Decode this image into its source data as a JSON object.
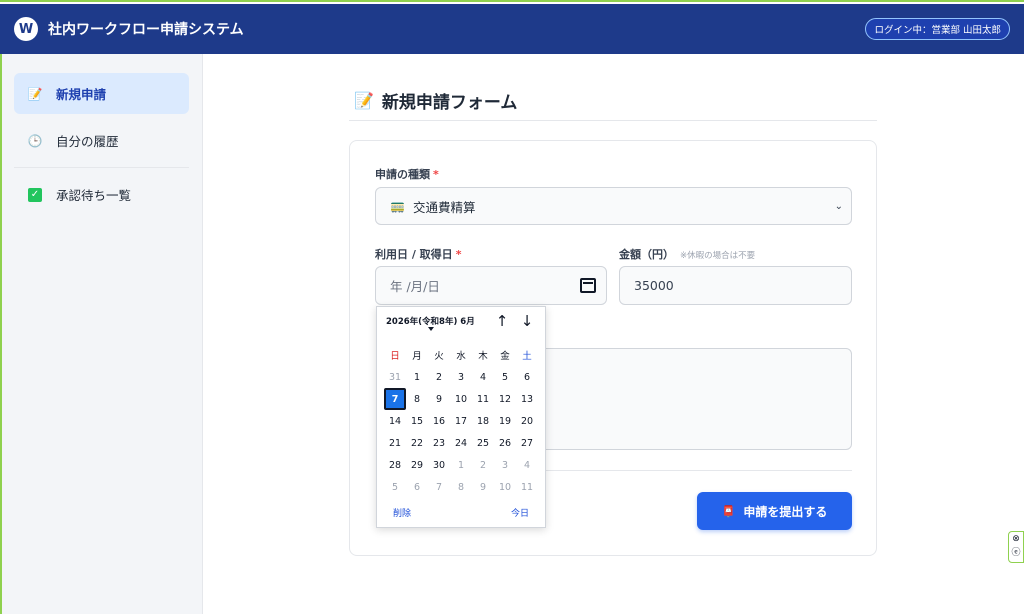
{
  "header": {
    "logo_letter": "W",
    "title": "社内ワークフロー申請システム",
    "login_status": "ログイン中：営業部 山田太郎"
  },
  "sidebar": {
    "items": [
      {
        "label": "新規申請",
        "icon": "memo-icon",
        "active": true
      },
      {
        "label": "自分の履歴",
        "icon": "clock-icon",
        "active": false
      },
      {
        "label": "承認待ち一覧",
        "icon": "checkbox-icon",
        "active": false
      }
    ]
  },
  "main": {
    "title": "新規申請フォーム",
    "title_icon": "memo-icon"
  },
  "form": {
    "type_label": "申請の種類",
    "type_required_mark": "*",
    "type_value": "交通費精算",
    "type_icon": "train-icon",
    "date_label": "利用日 / 取得日",
    "date_required_mark": "*",
    "date_placeholder": "年 /月/日",
    "amount_label": "金額（円）",
    "amount_note": "※休暇の場合は不要",
    "amount_value": "35000",
    "submit_label": "申請を提出する",
    "submit_icon": "mailbox-icon"
  },
  "datepicker": {
    "header": "2026年(令和8年) 6月",
    "weekdays": [
      "日",
      "月",
      "火",
      "水",
      "木",
      "金",
      "土"
    ],
    "weeks": [
      [
        "31",
        "1",
        "2",
        "3",
        "4",
        "5",
        "6"
      ],
      [
        "7",
        "8",
        "9",
        "10",
        "11",
        "12",
        "13"
      ],
      [
        "14",
        "15",
        "16",
        "17",
        "18",
        "19",
        "20"
      ],
      [
        "21",
        "22",
        "23",
        "24",
        "25",
        "26",
        "27"
      ],
      [
        "28",
        "29",
        "30",
        "1",
        "2",
        "3",
        "4"
      ],
      [
        "5",
        "6",
        "7",
        "8",
        "9",
        "10",
        "11"
      ]
    ],
    "selected": "7",
    "clear_label": "削除",
    "today_label": "今日"
  },
  "colors": {
    "header_bg": "#1e3a8a",
    "accent": "#2563eb",
    "active_nav_bg": "#dbeafe",
    "required": "#ef4444"
  }
}
